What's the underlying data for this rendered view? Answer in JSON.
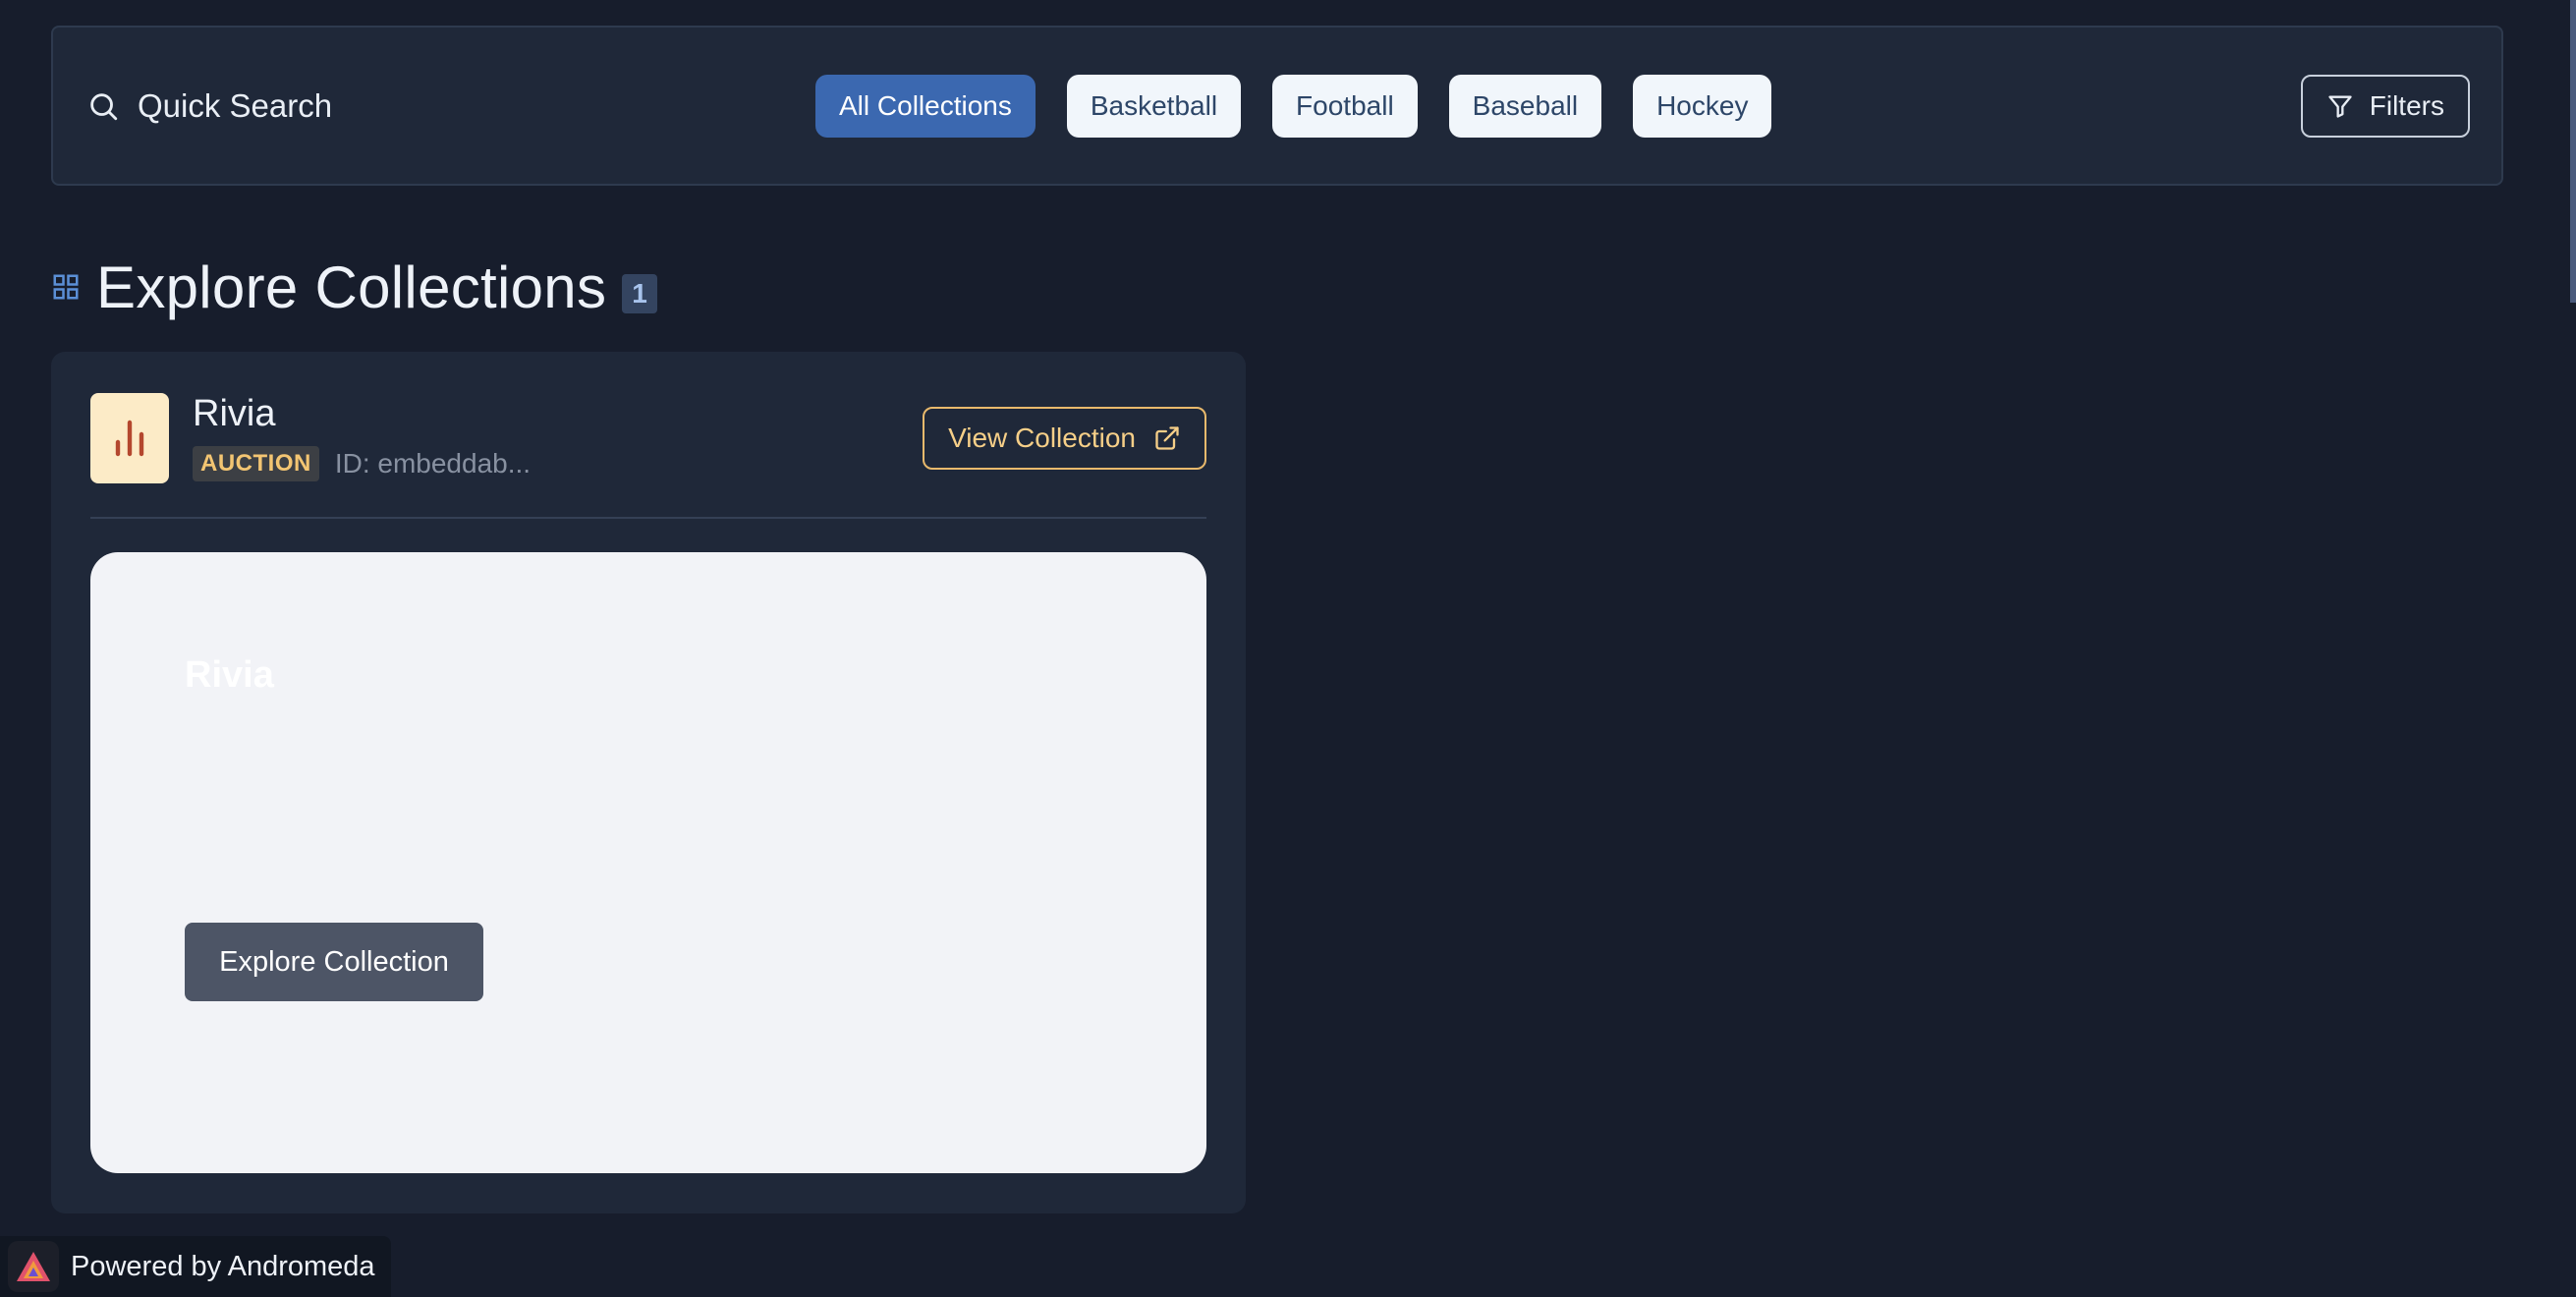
{
  "search": {
    "label": "Quick Search",
    "icon": "search-icon"
  },
  "filters": {
    "chips": [
      {
        "label": "All Collections",
        "active": true
      },
      {
        "label": "Basketball",
        "active": false
      },
      {
        "label": "Football",
        "active": false
      },
      {
        "label": "Baseball",
        "active": false
      },
      {
        "label": "Hockey",
        "active": false
      }
    ],
    "filters_label": "Filters"
  },
  "section": {
    "title": "Explore Collections",
    "count": "1"
  },
  "collection": {
    "name": "Rivia",
    "type_badge": "AUCTION",
    "id_text": "ID: embeddab...",
    "view_label": "View Collection",
    "preview_title": "Rivia",
    "explore_label": "Explore Collection"
  },
  "footer": {
    "powered_by": "Powered by Andromeda"
  },
  "colors": {
    "background": "#171d2c",
    "accent": "#3b68b0",
    "badge_text": "#f3c572",
    "view_button": "#e8b96c"
  }
}
